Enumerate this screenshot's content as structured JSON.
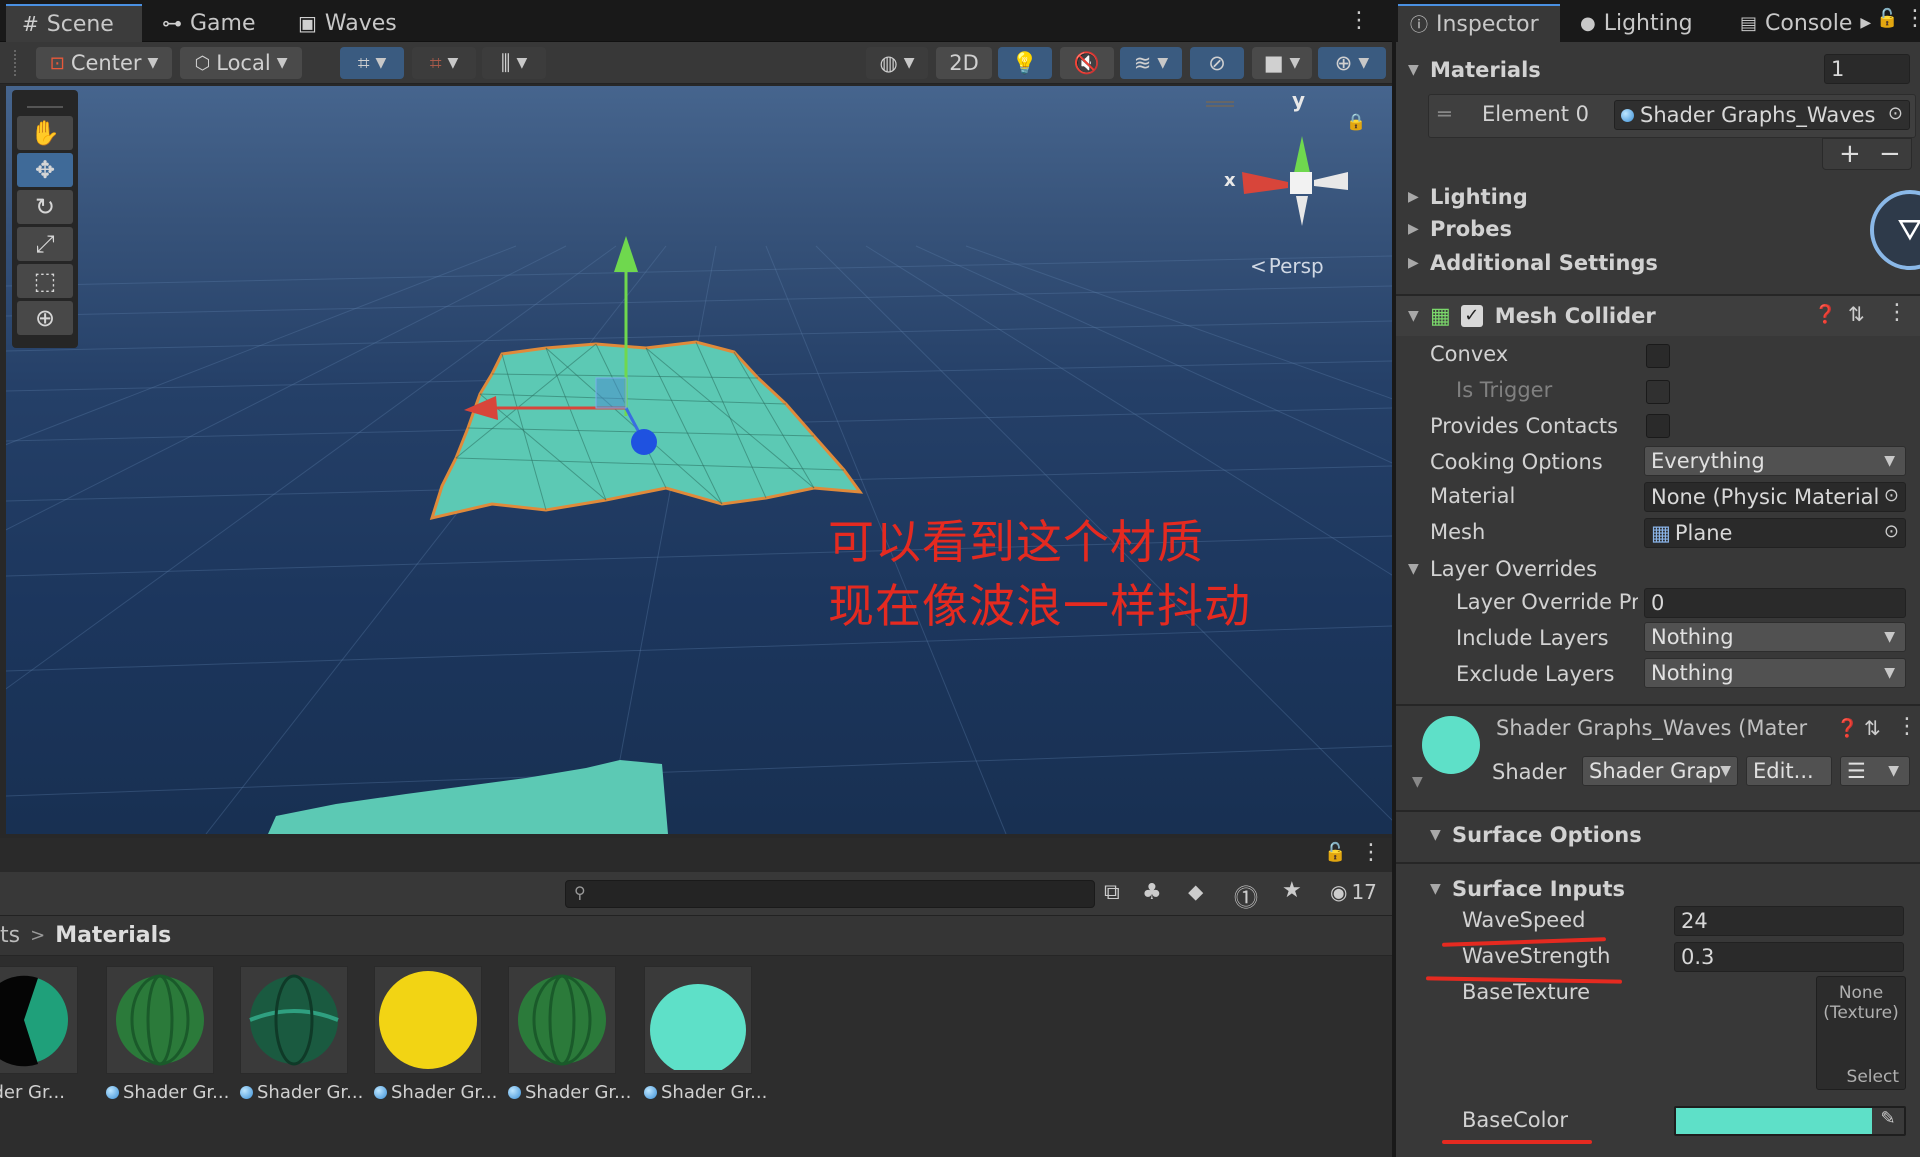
{
  "scene_tabs": [
    {
      "label": "Scene",
      "icon": "grid-icon"
    },
    {
      "label": "Game",
      "icon": "gamepad-icon"
    },
    {
      "label": "Waves",
      "icon": "lock-doc-icon"
    }
  ],
  "toolbar": {
    "pivot_label": "Center",
    "space_label": "Local",
    "mode_2d": "2D"
  },
  "gizmo": {
    "y_label": "y",
    "x_label": "x",
    "persp_label": "Persp"
  },
  "overlay_text": {
    "line1": "可以看到这个材质",
    "line2": "现在像波浪一样抖动"
  },
  "project": {
    "count": "17",
    "breadcrumb_prev": "ts",
    "breadcrumb_current": "Materials",
    "materials": [
      {
        "label": "hader Gr..."
      },
      {
        "label": "Shader Gr..."
      },
      {
        "label": "Shader Gr..."
      },
      {
        "label": "Shader Gr..."
      },
      {
        "label": "Shader Gr..."
      },
      {
        "label": "Shader Gr..."
      }
    ]
  },
  "inspector_tabs": [
    {
      "label": "Inspector"
    },
    {
      "label": "Lighting"
    },
    {
      "label": "Console"
    }
  ],
  "materials_section": {
    "title": "Materials",
    "size": "1",
    "element_label": "Element 0",
    "element_value": "Shader Graphs_Waves"
  },
  "collapsed_sections": [
    "Lighting",
    "Probes",
    "Additional Settings"
  ],
  "mesh_collider": {
    "title": "Mesh Collider",
    "convex": "Convex",
    "is_trigger": "Is Trigger",
    "provides_contacts": "Provides Contacts",
    "cooking_options_label": "Cooking Options",
    "cooking_options_value": "Everything",
    "material_label": "Material",
    "material_value": "None (Physic Material",
    "mesh_label": "Mesh",
    "mesh_value": "Plane",
    "layer_overrides": "Layer Overrides",
    "layer_priority_label": "Layer Override Pri",
    "layer_priority_value": "0",
    "include_label": "Include Layers",
    "include_value": "Nothing",
    "exclude_label": "Exclude Layers",
    "exclude_value": "Nothing"
  },
  "material_component": {
    "title": "Shader Graphs_Waves (Mater",
    "shader_label": "Shader",
    "shader_value": "Shader Grap",
    "edit_label": "Edit...",
    "surface_options": "Surface Options",
    "surface_inputs": "Surface Inputs",
    "wavespeed_label": "WaveSpeed",
    "wavespeed_value": "24",
    "wavestrength_label": "WaveStrength",
    "wavestrength_value": "0.3",
    "basetexture_label": "BaseTexture",
    "texture_none": "None",
    "texture_type": "(Texture)",
    "texture_select": "Select",
    "basecolor_label": "BaseColor",
    "basecolor_value": "#5ee0c8"
  }
}
